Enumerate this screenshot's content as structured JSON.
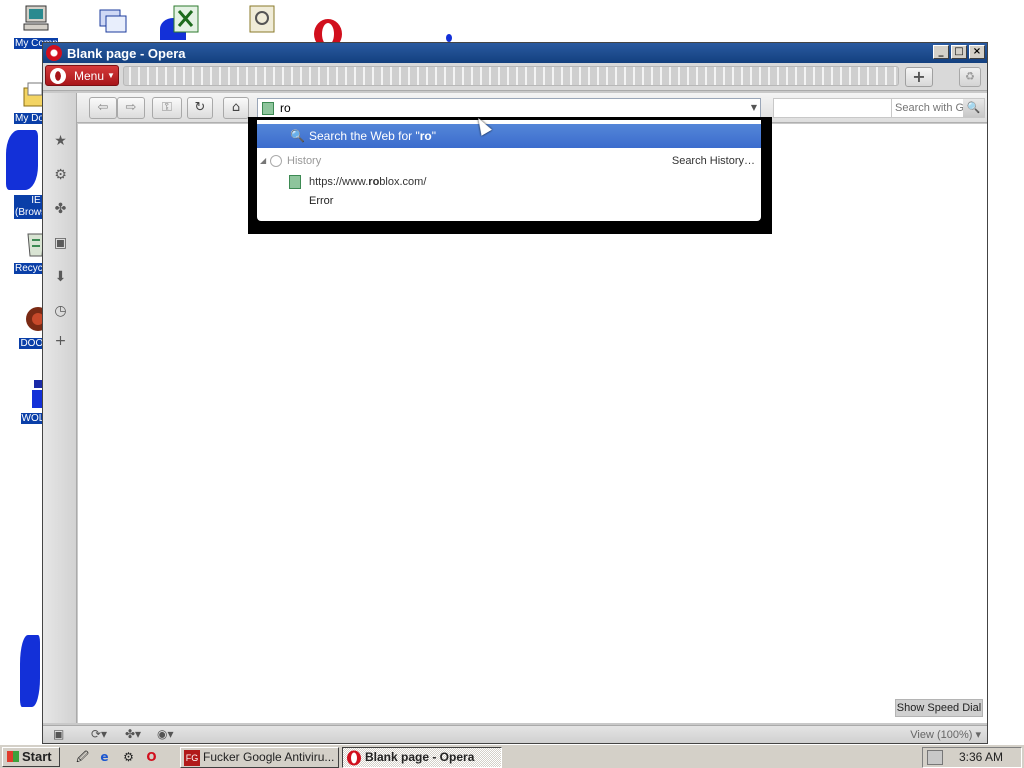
{
  "desktop": {
    "icons": [
      {
        "label": "My Computer",
        "icon": "computer-icon"
      },
      {
        "label": "My Documents",
        "icon": "documents-folder-icon"
      },
      {
        "label": "IE (Browser)",
        "icon": "ie-icon"
      },
      {
        "label": "Recycle Bin",
        "icon": "recycle-bin-icon"
      },
      {
        "label": "DOOM",
        "icon": "doom-icon"
      },
      {
        "label": "WOLF",
        "icon": "wolf-icon"
      }
    ],
    "top_icons": [
      "network-shortcut-icon",
      "excel-shortcut-icon",
      "control-panel-icon",
      "opera-icon"
    ]
  },
  "window": {
    "title": "Blank page - Opera",
    "buttons": {
      "minimize": "_",
      "maximize": "□",
      "close": "×"
    }
  },
  "toolbar": {
    "menu_label": "Menu",
    "new_tab_label": "+",
    "address_value": "ro",
    "search_placeholder": "Search with Google"
  },
  "dropdown": {
    "search_prefix": "Search the Web for \"",
    "search_query": "ro",
    "search_suffix": "\"",
    "history_heading": "History",
    "search_history_link": "Search History…",
    "history_url_prefix": "https://www.",
    "history_url_match": "ro",
    "history_url_suffix": "blox.com/",
    "history_title": "Error"
  },
  "content": {
    "speed_dial_label": "Show Speed Dial"
  },
  "statusbar": {
    "zoom_label": "View (100%)"
  },
  "taskbar": {
    "start_label": "Start",
    "tasks": [
      {
        "label": "Fucker Google Antiviru...",
        "icon": "antivirus-icon",
        "active": false
      },
      {
        "label": "Blank page - Opera",
        "icon": "opera-icon",
        "active": true
      }
    ],
    "clock": "3:36 AM"
  },
  "colors": {
    "accent_blue": "#3b6ccd",
    "opera_red": "#d10f1d",
    "title_blue": "#13407f"
  }
}
